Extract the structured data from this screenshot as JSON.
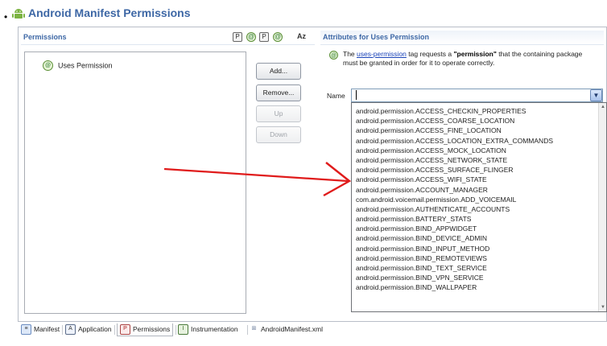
{
  "title": "Android Manifest Permissions",
  "left_panel": {
    "title": "Permissions",
    "header_icons": [
      "P",
      "@",
      "P",
      "@"
    ],
    "sort_label": "Az",
    "tree_items": [
      {
        "label": "Uses Permission",
        "icon": "green-circle-permission-icon"
      }
    ],
    "buttons": {
      "add": "Add...",
      "remove": "Remove...",
      "up": "Up",
      "down": "Down"
    }
  },
  "right_panel": {
    "title": "Attributes for Uses Permission",
    "description": {
      "prefix": "The ",
      "link": "uses-permission",
      "middle": " tag requests a ",
      "bold": "\"permission\"",
      "suffix": " that the containing package must be granted in order for it to operate correctly."
    },
    "name_label": "Name",
    "name_value": "",
    "dropdown_items": [
      "android.permission.ACCESS_CHECKIN_PROPERTIES",
      "android.permission.ACCESS_COARSE_LOCATION",
      "android.permission.ACCESS_FINE_LOCATION",
      "android.permission.ACCESS_LOCATION_EXTRA_COMMANDS",
      "android.permission.ACCESS_MOCK_LOCATION",
      "android.permission.ACCESS_NETWORK_STATE",
      "android.permission.ACCESS_SURFACE_FLINGER",
      "android.permission.ACCESS_WIFI_STATE",
      "android.permission.ACCOUNT_MANAGER",
      "com.android.voicemail.permission.ADD_VOICEMAIL",
      "android.permission.AUTHENTICATE_ACCOUNTS",
      "android.permission.BATTERY_STATS",
      "android.permission.BIND_APPWIDGET",
      "android.permission.BIND_DEVICE_ADMIN",
      "android.permission.BIND_INPUT_METHOD",
      "android.permission.BIND_REMOTEVIEWS",
      "android.permission.BIND_TEXT_SERVICE",
      "android.permission.BIND_VPN_SERVICE",
      "android.permission.BIND_WALLPAPER"
    ]
  },
  "tabs": [
    {
      "label": "Manifest",
      "icon": "M"
    },
    {
      "label": "Application",
      "icon": "A"
    },
    {
      "label": "Permissions",
      "icon": "P"
    },
    {
      "label": "Instrumentation",
      "icon": "I"
    },
    {
      "label": "AndroidManifest.xml",
      "icon": "xml"
    }
  ],
  "colors": {
    "title_blue": "#3d67a5",
    "annotation_arrow": "#e01b1b",
    "android_green": "#7cb342"
  }
}
